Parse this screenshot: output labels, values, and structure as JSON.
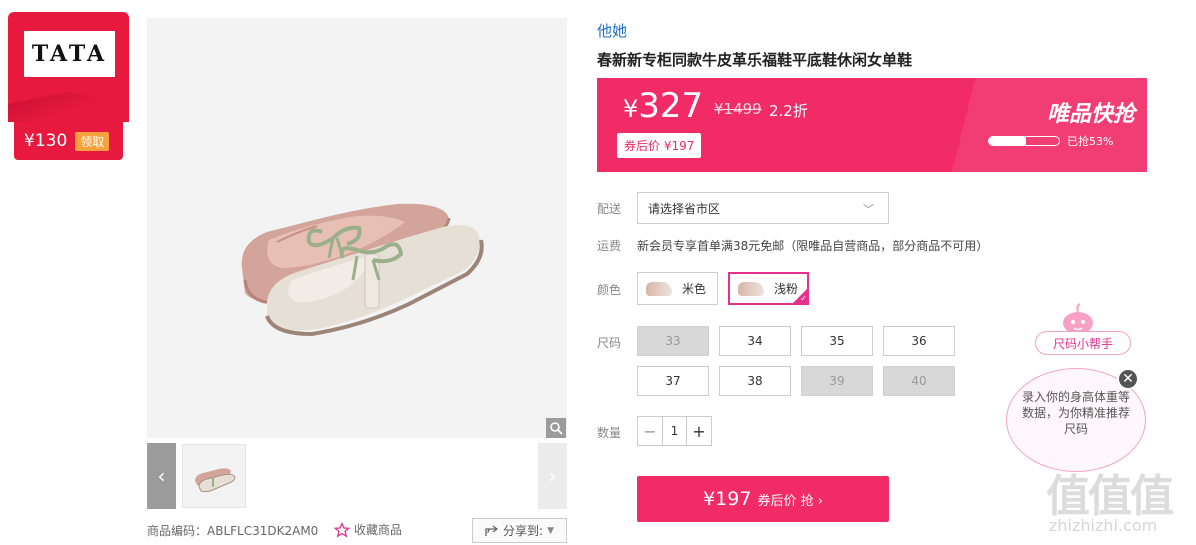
{
  "coupon": {
    "logo": "TATA",
    "price": "¥130",
    "claim_label": "领取"
  },
  "product": {
    "brand": "他她",
    "title": "春新新专柜同款牛皮革乐福鞋平底鞋休闲女单鞋",
    "sku_label": "商品编码：ABLFLC31DK2AM0",
    "favorite_label": "收藏商品",
    "share_label": "分享到:"
  },
  "price": {
    "currency": "¥",
    "current": "327",
    "original": "¥1499",
    "discount": "2.2折",
    "after_coupon": "券后价 ¥197",
    "flash_title": "唯品快抢",
    "sold_text": "已抢53%",
    "sold_fraction": 0.53
  },
  "delivery": {
    "label": "配送",
    "placeholder": "请选择省市区"
  },
  "shipping": {
    "label": "运费",
    "text": "新会员专享首单满38元免邮（限唯品自营商品，部分商品不可用）"
  },
  "colors": {
    "label": "颜色",
    "options": [
      {
        "name": "米色",
        "selected": false
      },
      {
        "name": "浅粉",
        "selected": true
      }
    ]
  },
  "sizes": {
    "label": "尺码",
    "options": [
      {
        "value": "33",
        "available": false
      },
      {
        "value": "34",
        "available": true
      },
      {
        "value": "35",
        "available": true
      },
      {
        "value": "36",
        "available": true
      },
      {
        "value": "37",
        "available": true
      },
      {
        "value": "38",
        "available": true
      },
      {
        "value": "39",
        "available": false
      },
      {
        "value": "40",
        "available": false
      }
    ]
  },
  "quantity": {
    "label": "数量",
    "value": "1"
  },
  "buy_button": {
    "amount": "¥197",
    "label": "券后价 抢 ›"
  },
  "size_helper": {
    "tag": "尺码小帮手",
    "bubble": "录入你的身高体重等数据，为你精准推荐尺码"
  },
  "watermark": {
    "text": "值值值",
    "url": "zhizhizhi.com"
  },
  "colors_theme": {
    "accent": "#f02b66",
    "pink": "#e5308d",
    "brand_blue": "#1a6fc9"
  }
}
